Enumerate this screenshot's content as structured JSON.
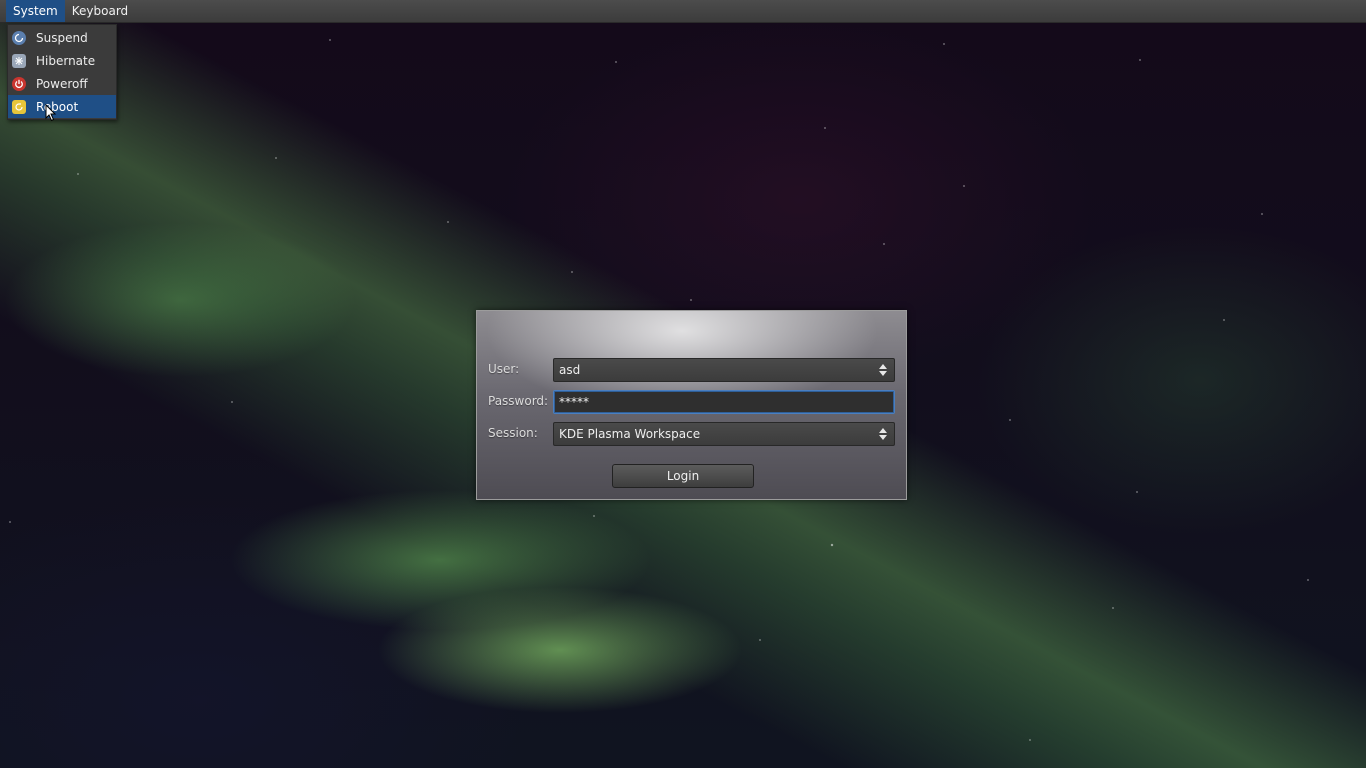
{
  "menubar": {
    "items": [
      {
        "label": "System",
        "active": true
      },
      {
        "label": "Keyboard",
        "active": false
      }
    ]
  },
  "system_menu": {
    "items": [
      {
        "label": "Suspend",
        "icon": "suspend-icon"
      },
      {
        "label": "Hibernate",
        "icon": "hibernate-icon"
      },
      {
        "label": "Poweroff",
        "icon": "poweroff-icon"
      },
      {
        "label": "Reboot",
        "icon": "reboot-icon",
        "highlighted": true
      }
    ]
  },
  "login": {
    "user_label": "User:",
    "user_value": "asd",
    "password_label": "Password:",
    "password_value": "*****",
    "session_label": "Session:",
    "session_value": "KDE Plasma Workspace",
    "login_button": "Login"
  },
  "colors": {
    "highlight": "#1f4f86",
    "menubar_bg": "#3c3c3c",
    "focus_border": "#4a7fc0"
  }
}
